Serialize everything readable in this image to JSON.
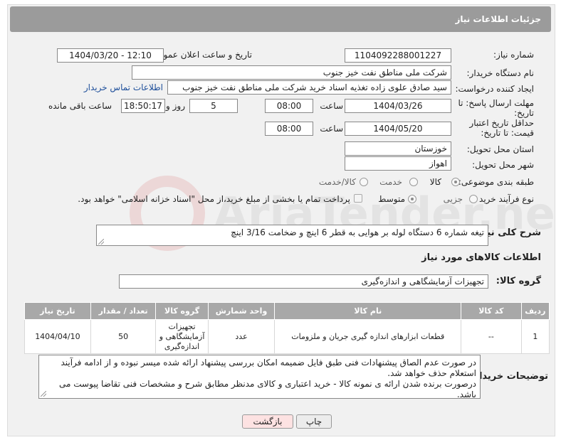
{
  "page": {
    "title": "جزئیات اطلاعات نیاز"
  },
  "form": {
    "need_number_label": "شماره نیاز:",
    "need_number": "1104092288001227",
    "announce_label": "تاریخ و ساعت اعلان عمومی:",
    "announce_value": "1404/03/20 - 12:10",
    "buyer_org_label": "نام دستگاه خریدار:",
    "buyer_org": "شرکت ملی مناطق نفت خیز جنوب",
    "requester_label": "ایجاد کننده درخواست:",
    "requester": "سید صادق علوی زاده  تغذیه اسناد خرید  شرکت ملی مناطق نفت خیز جنوب",
    "contact_link": "اطلاعات تماس خریدار",
    "reply_deadline_label": "مهلت ارسال پاسخ: تا تاریخ:",
    "reply_date": "1404/03/26",
    "time_label": "ساعت",
    "reply_time": "08:00",
    "days_value": "5",
    "days_label": "روز و",
    "remaining_time": "18:50:17",
    "remaining_label": "ساعت باقی مانده",
    "price_validity_label": "حداقل تاریخ اعتبار قیمت: تا تاریخ:",
    "price_date": "1404/05/20",
    "price_time": "08:00",
    "province_label": "استان محل تحویل:",
    "province": "خوزستان",
    "city_label": "شهر محل تحویل:",
    "city": "اهواز",
    "category_label": "طبقه بندی موضوعی:",
    "category_options": [
      "کالا",
      "خدمت",
      "کالا/خدمت"
    ],
    "process_label": "نوع فرآیند خرید :",
    "process_options": [
      "جزیی",
      "متوسط"
    ],
    "payment_note": "پرداخت تمام یا بخشی از مبلغ خرید،از محل \"اسناد خزانه اسلامی\" خواهد بود.",
    "description_label": "شرح کلی نیاز:",
    "description": "تیغه شماره 6 دستگاه لوله بر هوایی به قطر 6 اینچ و ضخامت 3/16 اینچ",
    "goods_info_title": "اطلاعات کالاهای مورد نیاز",
    "goods_group_label": "گروه کالا:",
    "goods_group": "تجهیزات آزمایشگاهی و اندازه‌گیری"
  },
  "table": {
    "headers": [
      "ردیف",
      "کد کالا",
      "نام کالا",
      "واحد شمارش",
      "گروه کالا",
      "تعداد / مقدار",
      "تاریخ نیاز"
    ],
    "rows": [
      [
        "1",
        "--",
        "قطعات ابزارهای اندازه گیری جریان و ملزومات",
        "عدد",
        "تجهیزات آزمایشگاهی و اندازه‌گیری",
        "50",
        "1404/04/10"
      ]
    ]
  },
  "notes": {
    "label": "توضیحات خریدار:",
    "text": "در صورت عدم الصاق پیشنهادات فنی طبق فایل ضمیمه امکان بررسی پیشنهاد ارائه شده میسر نبوده و از ادامه فرآیند استعلام حذف خواهد شد.\nدرصورت برنده شدن ارائه ی نمونه کالا - خرید اعتباری و کالای مدنظر مطابق شرح و مشخصات فنی تقاضا پیوست می باشد."
  },
  "buttons": {
    "print": "چاپ",
    "back": "بازگشت"
  },
  "watermark": {
    "text": "AriaTender.neT"
  }
}
